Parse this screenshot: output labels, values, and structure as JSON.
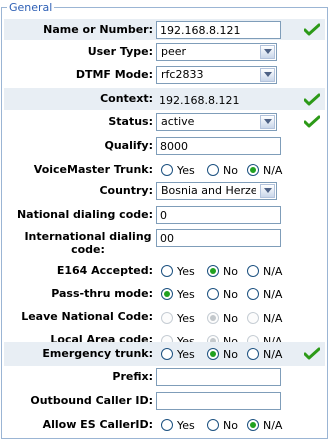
{
  "fieldset": {
    "legend": "General"
  },
  "icons": {
    "check": "green-check-icon",
    "dropdown": "chevron-down-icon"
  },
  "colors": {
    "check": "#2d9a18",
    "radio_selected": "#21a121",
    "legend": "#2d5fb5",
    "highlight_row": "#e8eef4"
  },
  "fields": {
    "name_or_number": {
      "label": "Name or Number:",
      "value": "192.168.8.121"
    },
    "user_type": {
      "label": "User Type:",
      "value": "peer"
    },
    "dtmf_mode": {
      "label": "DTMF Mode:",
      "value": "rfc2833"
    },
    "context": {
      "label": "Context:",
      "value": "192.168.8.121"
    },
    "status": {
      "label": "Status:",
      "value": "active"
    },
    "qualify": {
      "label": "Qualify:",
      "value": "8000"
    },
    "voicemaster_trunk": {
      "label": "VoiceMaster Trunk:",
      "selected": "N/A"
    },
    "country": {
      "label": "Country:",
      "value": "Bosnia and Herzego"
    },
    "national_dialing_code": {
      "label": "National dialing code:",
      "value": "0"
    },
    "international_dialing_code": {
      "label": "International dialing code:",
      "value": "00"
    },
    "e164_accepted": {
      "label": "E164 Accepted:",
      "selected": "No"
    },
    "pass_thru_mode": {
      "label": "Pass-thru mode:",
      "selected": "Yes"
    },
    "leave_national_code": {
      "label": "Leave National Code:",
      "selected": "No",
      "disabled": true
    },
    "local_area_code": {
      "label": "Local Area code:",
      "selected": "No",
      "disabled": true
    },
    "emergency_trunk": {
      "label": "Emergency trunk:",
      "selected": "No"
    },
    "prefix": {
      "label": "Prefix:",
      "value": ""
    },
    "outbound_caller_id": {
      "label": "Outbound Caller ID:",
      "value": ""
    },
    "allow_es_callerid": {
      "label": "Allow ES CallerID:",
      "selected": "N/A"
    }
  },
  "radio_options": {
    "yes": "Yes",
    "no": "No",
    "na": "N/A"
  }
}
